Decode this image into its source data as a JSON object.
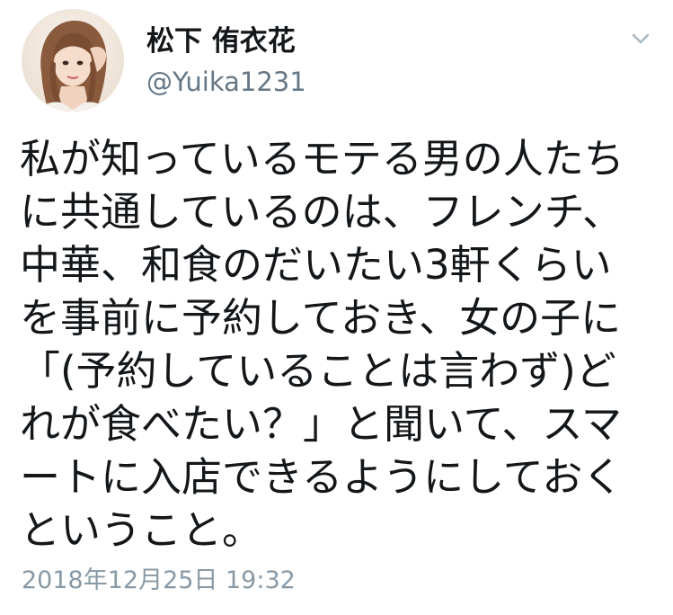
{
  "tweet": {
    "author": {
      "display_name": "松下 侑衣花",
      "handle": "@Yuika1231"
    },
    "text_lines": [
      "私が知っているモテる男の人たち",
      "に共通しているのは、フレンチ、",
      "中華、和食のだいたい3軒くらい",
      "を事前に予約しておき、女の子に",
      "「(予約していることは言わず)ど",
      "れが食べたい？」と聞いて、スマ",
      "ートに入店できるようにしておく",
      "ということ。"
    ],
    "timestamp": "2018年12月25日 19:32"
  },
  "icons": {
    "menu": "chevron-down-icon",
    "avatar": "profile-photo"
  },
  "colors": {
    "text": "#14171a",
    "secondary_text": "#657786",
    "timestamp_text": "#8899a6",
    "chevron": "#aab8c2",
    "background": "#ffffff"
  }
}
